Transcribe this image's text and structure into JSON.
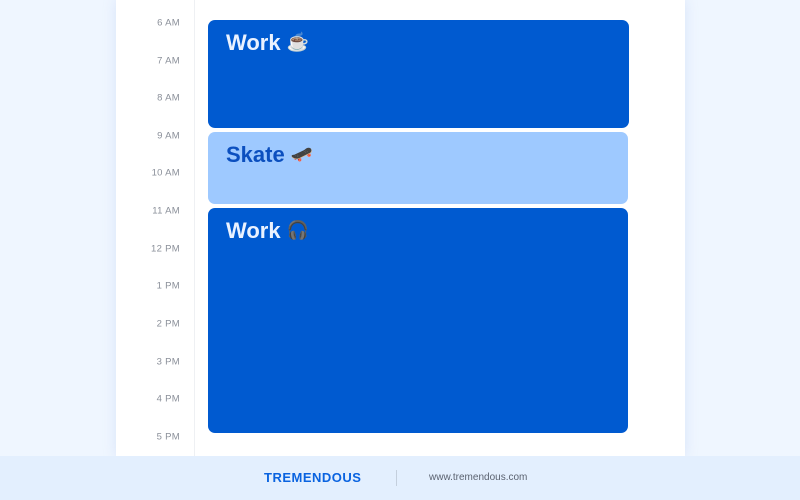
{
  "calendar": {
    "time_labels": [
      "6 AM",
      "7 AM",
      "8 AM",
      "9 AM",
      "10 AM",
      "11 AM",
      "12 PM",
      "1 PM",
      "2 PM",
      "3 PM",
      "4 PM",
      "5 PM"
    ],
    "events": [
      {
        "title": "Work",
        "emoji": "☕",
        "emoji_name": "coffee-icon",
        "style": "dark",
        "start": "6 AM",
        "end": "9 AM"
      },
      {
        "title": "Skate",
        "emoji": "🛹",
        "emoji_name": "skateboard-icon",
        "style": "light",
        "start": "9 AM",
        "end": "11 AM"
      },
      {
        "title": "Work",
        "emoji": "🎧",
        "emoji_name": "headphones-icon",
        "style": "dark",
        "start": "11 AM",
        "end": "5 PM"
      }
    ]
  },
  "colors": {
    "event_dark": "#005ad0",
    "event_light": "#9ec9ff",
    "brand": "#0a63e0",
    "page_bg": "#eff6ff",
    "footer_bg": "#e3effe"
  },
  "footer": {
    "brand": "TREMENDOUS",
    "url": "www.tremendous.com"
  }
}
